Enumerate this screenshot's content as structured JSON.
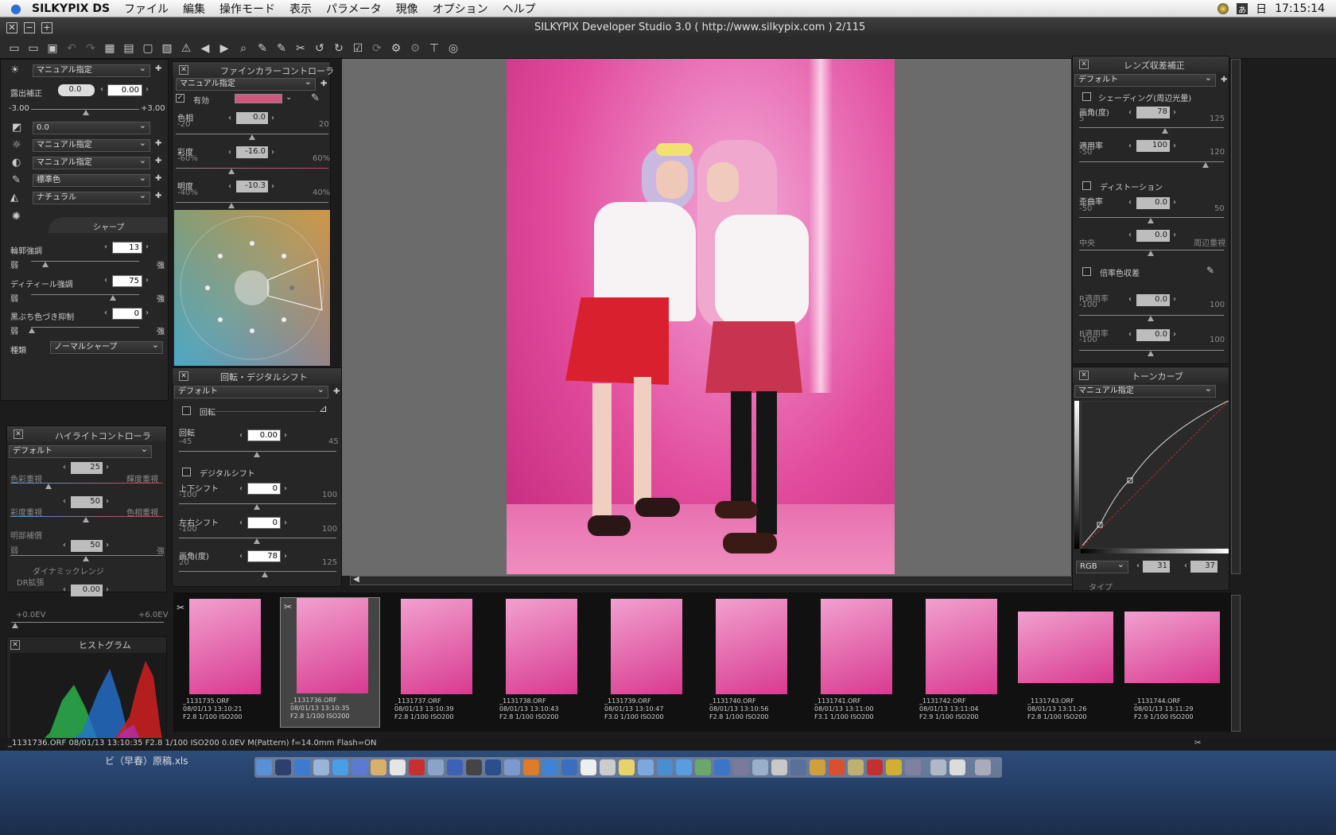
{
  "menubar": {
    "app": "SILKYPIX DS",
    "items": [
      "ファイル",
      "編集",
      "操作モード",
      "表示",
      "パラメータ",
      "現像",
      "オプション",
      "ヘルプ"
    ],
    "day": "日",
    "clock": "17:15:14"
  },
  "window": {
    "title": "SILKYPIX Developer Studio 3.0 ( http://www.silkypix.com )   2/115"
  },
  "left": {
    "wb": "マニュアル指定",
    "exposure_label": "露出補正",
    "exposure_btn": "0.0",
    "exposure_val": "0.00",
    "exp_min": "-3.00",
    "exp_max": "+3.00",
    "contrast": "0.0",
    "tone": "マニュアル指定",
    "gamma": "マニュアル指定",
    "color": "標準色",
    "style": "ナチュラル",
    "sharp_title": "シャープ",
    "edge_label": "輪郭強調",
    "edge_val": "13",
    "detail_label": "ディティール強調",
    "detail_val": "75",
    "fringe_label": "黒ぶち色づき抑制",
    "fringe_val": "0",
    "weak": "弱",
    "strong": "強",
    "kind_label": "種類",
    "kind": "ノーマルシャープ"
  },
  "fine": {
    "title": "ファインカラーコントローラ",
    "preset": "マニュアル指定",
    "enabled": "有効",
    "hue_label": "色相",
    "hue_min": "-20",
    "hue_max": "20",
    "hue_val": "0.0",
    "sat_label": "彩度",
    "sat_min": "-60%",
    "sat_max": "60%",
    "sat_val": "-16.0",
    "light_label": "明度",
    "light_min": "-40%",
    "light_max": "40%",
    "light_val": "-10.3",
    "accent": "#d0587e"
  },
  "highlight": {
    "title": "ハイライトコントローラ",
    "preset": "デフォルト",
    "v1": "25",
    "l1a": "色彩重視",
    "l1b": "輝度重視",
    "v2": "50",
    "l2a": "彩度重視",
    "l2b": "色相重視",
    "l3": "明部補償",
    "v3": "50",
    "weak": "弱",
    "strong": "強",
    "dr": "ダイナミックレンジ",
    "dr_label": "DR拡張",
    "dr_val": "0.00",
    "dr_min": "+0.0EV",
    "dr_max": "+6.0EV"
  },
  "histogram": {
    "title": "ヒストグラム"
  },
  "rotate": {
    "title": "回転・デジタルシフト",
    "preset": "デフォルト",
    "rot_chk": "回転",
    "rot_label": "回転",
    "rot_min": "-45",
    "rot_max": "45",
    "rot_val": "0.00",
    "ds_chk": "デジタルシフト",
    "ud_label": "上下シフト",
    "ud_min": "-100",
    "ud_max": "100",
    "ud_val": "0",
    "lr_label": "左右シフト",
    "lr_min": "-100",
    "lr_max": "100",
    "lr_val": "0",
    "ang_label": "画角(度)",
    "ang_min": "20",
    "ang_max": "125",
    "ang_val": "78"
  },
  "lens": {
    "title": "レンズ収差補正",
    "preset": "デフォルト",
    "shade_chk": "シェーディング(周辺光量)",
    "ang_label": "画角(度)",
    "ang_min": "5",
    "ang_max": "125",
    "ang_val": "78",
    "apply_label": "適用率",
    "apply_min": "-50",
    "apply_max": "120",
    "apply_val": "100",
    "dist_chk": "ディストーション",
    "distort_label": "歪曲率",
    "distort_min": "-50",
    "distort_max": "50",
    "distort_val": "0.0",
    "center_label": "中央",
    "edge_label": "周辺重視",
    "center_val": "0.0",
    "ca_chk": "倍率色収差",
    "r_label": "R適用率",
    "r_min": "-100",
    "r_max": "100",
    "r_val": "0.0",
    "b_label": "B適用率",
    "b_min": "-100",
    "b_max": "100",
    "b_val": "0.0"
  },
  "tone": {
    "title": "トーンカーブ",
    "preset": "マニュアル指定",
    "channel": "RGB",
    "in_val": "31",
    "out_val": "37",
    "type_label": "タイプ"
  },
  "thumbs": [
    {
      "name": "_1131735.ORF",
      "date": "08/01/13 13:10:21",
      "info": "F2.8 1/100 ISO200"
    },
    {
      "name": "_1131736.ORF",
      "date": "08/01/13 13:10:35",
      "info": "F2.8 1/100 ISO200"
    },
    {
      "name": "_1131737.ORF",
      "date": "08/01/13 13:10:39",
      "info": "F2.8 1/100 ISO200"
    },
    {
      "name": "_1131738.ORF",
      "date": "08/01/13 13:10:43",
      "info": "F2.8 1/100 ISO200"
    },
    {
      "name": "_1131739.ORF",
      "date": "08/01/13 13:10:47",
      "info": "F3.0 1/100 ISO200"
    },
    {
      "name": "_1131740.ORF",
      "date": "08/01/13 13:10:56",
      "info": "F2.8 1/100 ISO200"
    },
    {
      "name": "_1131741.ORF",
      "date": "08/01/13 13:11:00",
      "info": "F3.1 1/100 ISO200"
    },
    {
      "name": "_1131742.ORF",
      "date": "08/01/13 13:11:04",
      "info": "F2.9 1/100 ISO200"
    },
    {
      "name": "_1131743.ORF",
      "date": "08/01/13 13:11:26",
      "info": "F2.8 1/100 ISO200"
    },
    {
      "name": "_1131744.ORF",
      "date": "08/01/13 13:11:29",
      "info": "F2.9 1/100 ISO200"
    }
  ],
  "status": "_1131736.ORF 08/01/13 13:10:35 F2.8 1/100 ISO200  0.0EV M(Pattern) f=14.0mm Flash=ON",
  "desktop": {
    "file": "ビ（早春）原稿.xls"
  }
}
